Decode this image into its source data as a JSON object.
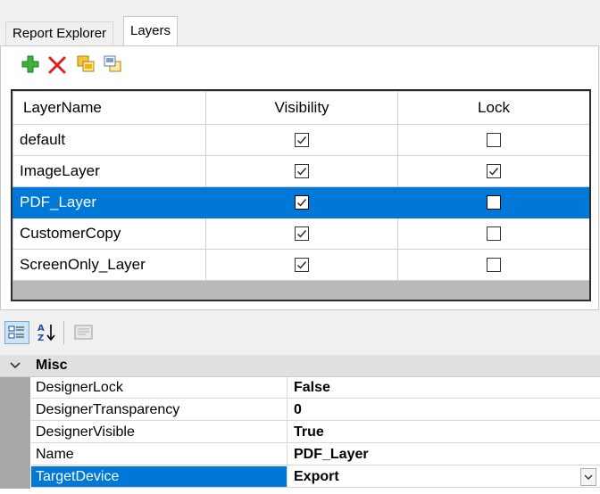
{
  "tabs": [
    {
      "label": "Report Explorer",
      "active": false
    },
    {
      "label": "Layers",
      "active": true
    }
  ],
  "layer_toolbar": [
    "add-icon",
    "delete-icon",
    "bring-to-front-icon",
    "send-to-back-icon"
  ],
  "layer_grid": {
    "columns": [
      "LayerName",
      "Visibility",
      "Lock"
    ],
    "rows": [
      {
        "name": "default",
        "visible": true,
        "lock": false,
        "selected": false
      },
      {
        "name": "ImageLayer",
        "visible": true,
        "lock": true,
        "selected": false
      },
      {
        "name": "PDF_Layer",
        "visible": true,
        "lock": false,
        "selected": true
      },
      {
        "name": "CustomerCopy",
        "visible": true,
        "lock": false,
        "selected": false
      },
      {
        "name": "ScreenOnly_Layer",
        "visible": true,
        "lock": false,
        "selected": false
      }
    ]
  },
  "property_toolbar": [
    "categorized-icon",
    "alphabetical-sort-icon",
    "property-pages-icon"
  ],
  "property_grid": {
    "category": "Misc",
    "properties": [
      {
        "name": "DesignerLock",
        "value": "False",
        "selected": false
      },
      {
        "name": "DesignerTransparency",
        "value": "0",
        "selected": false
      },
      {
        "name": "DesignerVisible",
        "value": "True",
        "selected": false
      },
      {
        "name": "Name",
        "value": "PDF_Layer",
        "selected": false
      },
      {
        "name": "TargetDevice",
        "value": "Export",
        "selected": true
      }
    ]
  },
  "colors": {
    "selection": "#0078d7",
    "gutter": "#a8a8a8"
  }
}
